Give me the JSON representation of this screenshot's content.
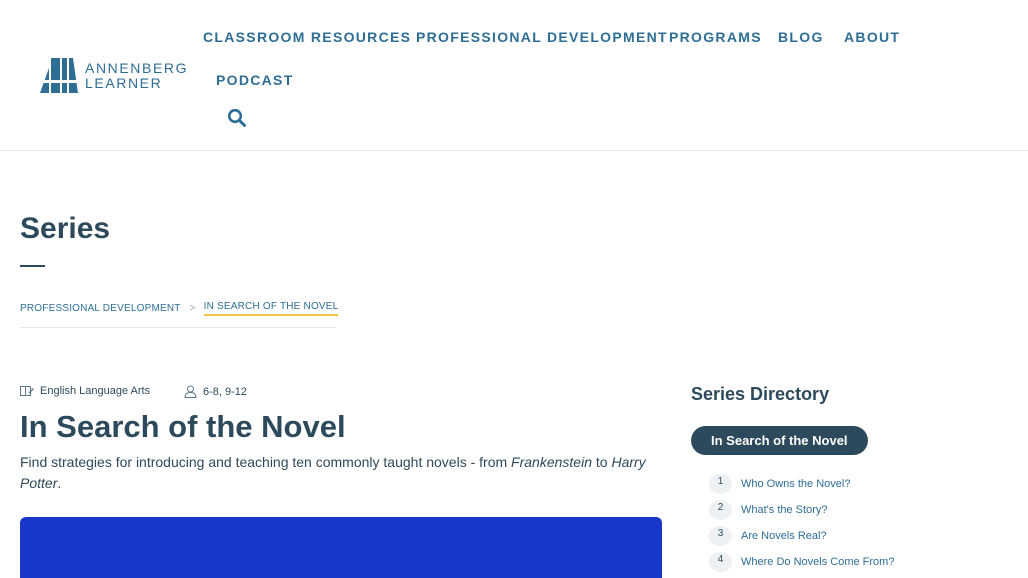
{
  "brand": {
    "line1": "ANNENBERG",
    "line2": "LEARNER",
    "color": "#2e6e95"
  },
  "nav": {
    "items": [
      {
        "label": "CLASSROOM RESOURCES"
      },
      {
        "label": "PROFESSIONAL DEVELOPMENT"
      },
      {
        "label": "PROGRAMS"
      },
      {
        "label": "BLOG"
      },
      {
        "label": "ABOUT"
      },
      {
        "label": "PODCAST"
      }
    ],
    "search_icon": "search-icon"
  },
  "page": {
    "title": "Series"
  },
  "breadcrumb": {
    "items": [
      {
        "label": "PROFESSIONAL DEVELOPMENT"
      },
      {
        "label": "IN SEARCH OF THE NOVEL"
      }
    ],
    "separator": ">"
  },
  "meta": {
    "subject": "English Language Arts",
    "grades": "6-8, 9-12"
  },
  "series": {
    "title": "In Search of the Novel",
    "desc_before": "Find strategies for introducing and teaching ten commonly taught novels - from ",
    "desc_em1": "Frankenstein",
    "desc_middle": " to ",
    "desc_em2": "Harry Potter",
    "desc_after": "."
  },
  "directory": {
    "title": "Series Directory",
    "active": "In Search of the Novel",
    "episodes": [
      {
        "num": "1",
        "title": "Who Owns the Novel?"
      },
      {
        "num": "2",
        "title": "What's the Story?"
      },
      {
        "num": "3",
        "title": "Are Novels Real?"
      },
      {
        "num": "4",
        "title": "Where Do Novels Come From?"
      }
    ]
  },
  "colors": {
    "heading": "#2d4a5c",
    "link": "#2e6e95",
    "accent": "#f5c24a",
    "video": "#1836c8"
  }
}
